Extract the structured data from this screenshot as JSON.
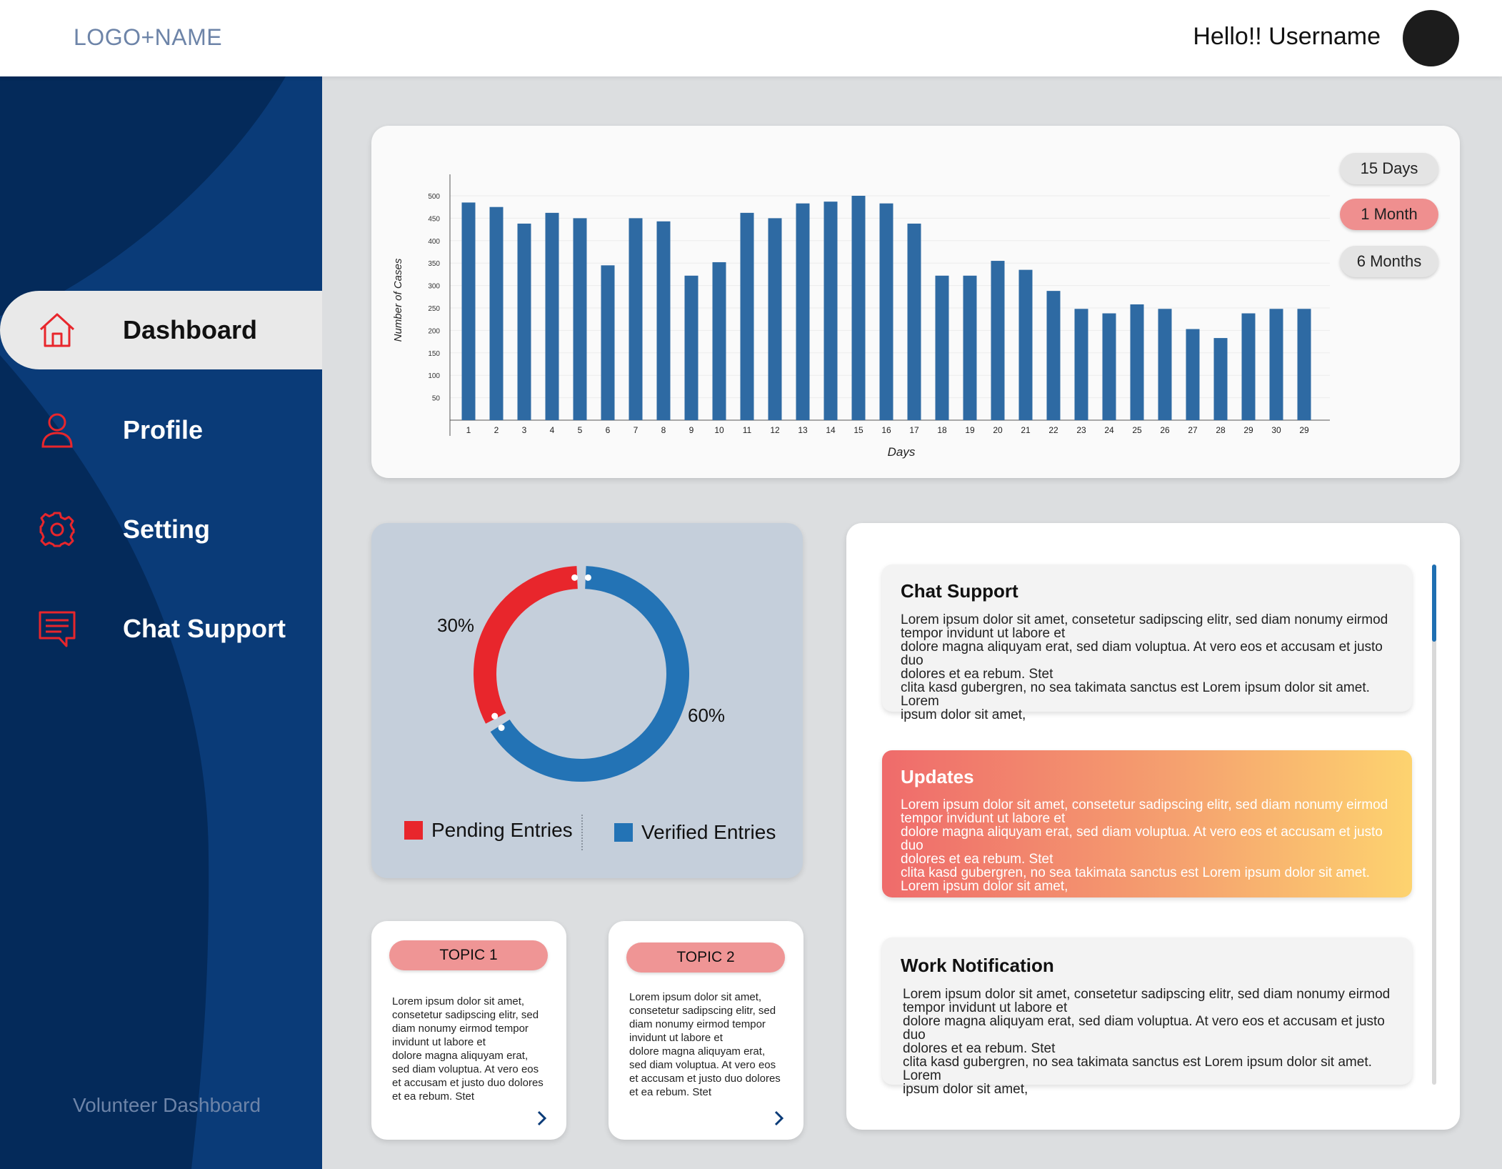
{
  "header": {
    "logo": "LOGO+NAME",
    "greeting": "Hello!! Username"
  },
  "sidebar": {
    "items": [
      {
        "label": "Dashboard",
        "icon": "home-icon",
        "active": true
      },
      {
        "label": "Profile",
        "icon": "user-icon",
        "active": false
      },
      {
        "label": "Setting",
        "icon": "gear-icon",
        "active": false
      },
      {
        "label": "Chat Support",
        "icon": "chat-icon",
        "active": false
      }
    ],
    "footer": "Volunteer Dashboard"
  },
  "colors": {
    "sidebar_blue": "#0a3b78",
    "bar_blue": "#2e6aa3",
    "accent_red": "#e8262c",
    "pill_pink": "#ef8f8f"
  },
  "range_buttons": {
    "days15": "15 Days",
    "month1": "1 Month",
    "months6": "6 Months",
    "selected": "1 Month"
  },
  "chart_data": [
    {
      "type": "bar",
      "xlabel": "Days",
      "ylabel": "Number of Cases",
      "ylim": [
        0,
        500
      ],
      "yticks": [
        50,
        100,
        150,
        200,
        250,
        300,
        350,
        400,
        450,
        500
      ],
      "grid": true,
      "categories": [
        "1",
        "2",
        "3",
        "4",
        "5",
        "6",
        "7",
        "8",
        "9",
        "10",
        "11",
        "12",
        "13",
        "14",
        "15",
        "16",
        "17",
        "18",
        "19",
        "20",
        "21",
        "22",
        "23",
        "24",
        "25",
        "26",
        "27",
        "28",
        "29",
        "30",
        "29"
      ],
      "values": [
        485,
        475,
        438,
        462,
        450,
        345,
        450,
        443,
        322,
        352,
        462,
        450,
        483,
        487,
        500,
        483,
        438,
        322,
        322,
        355,
        335,
        288,
        248,
        238,
        258,
        248,
        203,
        183,
        238,
        248,
        248
      ]
    },
    {
      "type": "pie",
      "labels": [
        "Pending Entries",
        "Verified Entries"
      ],
      "values": [
        30,
        60
      ],
      "value_labels": [
        "30%",
        "60%"
      ],
      "colors": [
        "#e8262c",
        "#2373b5"
      ]
    }
  ],
  "topics": [
    {
      "title": "TOPIC 1",
      "lines": [
        "Lorem ipsum dolor sit amet,",
        "consetetur sadipscing elitr, sed",
        "diam nonumy eirmod tempor",
        "invidunt ut labore et",
        "dolore magna aliquyam erat,",
        "sed diam voluptua. At vero eos",
        "et accusam et justo duo dolores",
        "et ea rebum. Stet"
      ]
    },
    {
      "title": "TOPIC 2",
      "lines": [
        "Lorem ipsum dolor sit amet,",
        "consetetur sadipscing elitr, sed",
        "diam nonumy eirmod tempor",
        "invidunt ut labore et",
        "dolore magna aliquyam erat,",
        "sed diam voluptua. At vero eos",
        "et accusam et justo duo dolores",
        "et ea rebum. Stet"
      ]
    }
  ],
  "notifications": [
    {
      "title": "Chat Support",
      "lines": [
        "Lorem ipsum dolor sit amet, consetetur sadipscing elitr, sed diam nonumy eirmod",
        "tempor invidunt ut labore et",
        "dolore magna aliquyam erat, sed diam voluptua. At vero eos et accusam et justo duo",
        "dolores et ea rebum. Stet",
        "clita kasd gubergren, no sea takimata sanctus est Lorem ipsum dolor sit amet. Lorem",
        "ipsum dolor sit amet,"
      ]
    },
    {
      "title": "Updates",
      "lines": [
        "Lorem ipsum dolor sit amet, consetetur sadipscing elitr, sed diam nonumy eirmod",
        "tempor invidunt ut labore et",
        "dolore magna aliquyam erat, sed diam voluptua. At vero eos et accusam et justo duo",
        "dolores et ea rebum. Stet",
        "clita kasd gubergren, no sea takimata sanctus est Lorem ipsum dolor sit amet.",
        "Lorem ipsum dolor sit amet,"
      ]
    },
    {
      "title": "Work Notification",
      "lines": [
        "Lorem ipsum dolor sit amet, consetetur sadipscing elitr, sed diam nonumy eirmod",
        "tempor invidunt ut labore et",
        "dolore magna aliquyam erat, sed diam voluptua. At vero eos et accusam et justo duo",
        "dolores et ea rebum. Stet",
        "clita kasd gubergren, no sea takimata sanctus est Lorem ipsum dolor sit amet. Lorem",
        "ipsum dolor sit amet,"
      ]
    }
  ]
}
